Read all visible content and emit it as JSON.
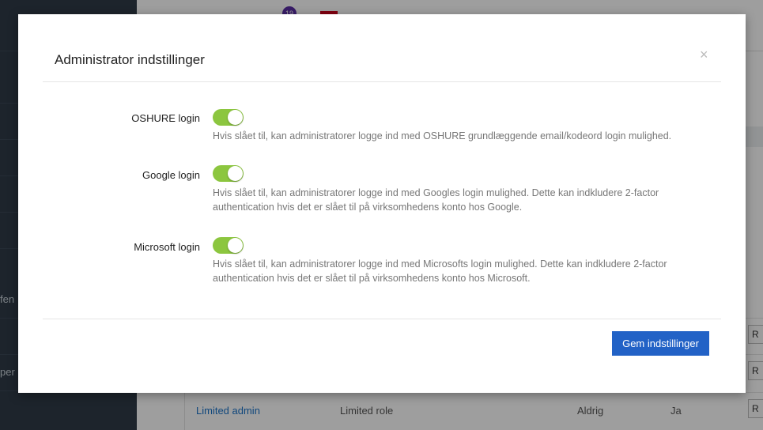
{
  "background": {
    "notification_count": "19",
    "sidebar_fragments": [
      "fen",
      "per"
    ],
    "table_row": {
      "name": "Limited admin",
      "role": "Limited role",
      "last_login": "Aldrig",
      "active": "Ja"
    },
    "row_button_label": "R"
  },
  "modal": {
    "title": "Administrator indstillinger",
    "close_label": "×",
    "settings": [
      {
        "label": "OSHURE login",
        "enabled": true,
        "help": "Hvis slået til, kan administratorer logge ind med OSHURE grundlæggende email/kodeord login mulighed."
      },
      {
        "label": "Google login",
        "enabled": true,
        "help": "Hvis slået til, kan administratorer logge ind med Googles login mulighed. Dette kan indkludere 2-factor authentication hvis det er slået til på virksomhedens konto hos Google."
      },
      {
        "label": "Microsoft login",
        "enabled": true,
        "help": "Hvis slået til, kan administratorer logge ind med Microsofts login mulighed. Dette kan indkludere 2-factor authentication hvis det er slået til på virksomhedens konto hos Microsoft."
      }
    ],
    "save_label": "Gem indstillinger"
  },
  "colors": {
    "toggle_on": "#8cc63f",
    "primary_button": "#2262c6",
    "sidebar": "#2f3b47"
  }
}
